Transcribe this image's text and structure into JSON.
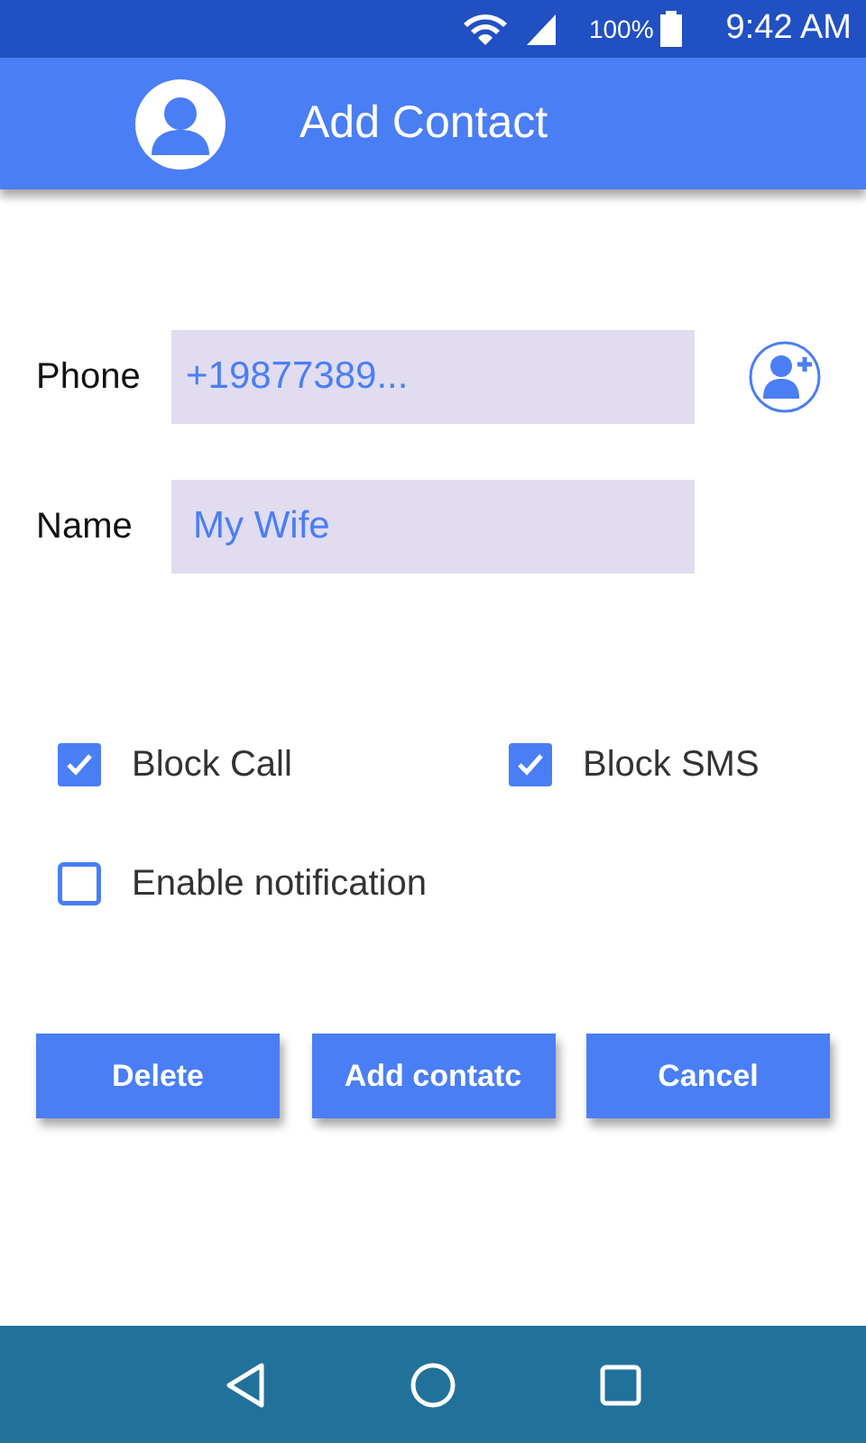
{
  "status_bar": {
    "battery": "100%",
    "time": "9:42 AM"
  },
  "app_bar": {
    "title": "Add Contact"
  },
  "fields": [
    {
      "label": "Phone",
      "value": "+19877389...",
      "kind": "phone"
    },
    {
      "label": "Name",
      "value": "My Wife",
      "kind": "name"
    }
  ],
  "options": [
    {
      "label": "Block Call",
      "checked": true
    },
    {
      "label": "Block SMS",
      "checked": true
    },
    {
      "label": "Enable notification",
      "checked": false
    }
  ],
  "buttons": [
    "Delete",
    "Add contatc",
    "Cancel"
  ]
}
